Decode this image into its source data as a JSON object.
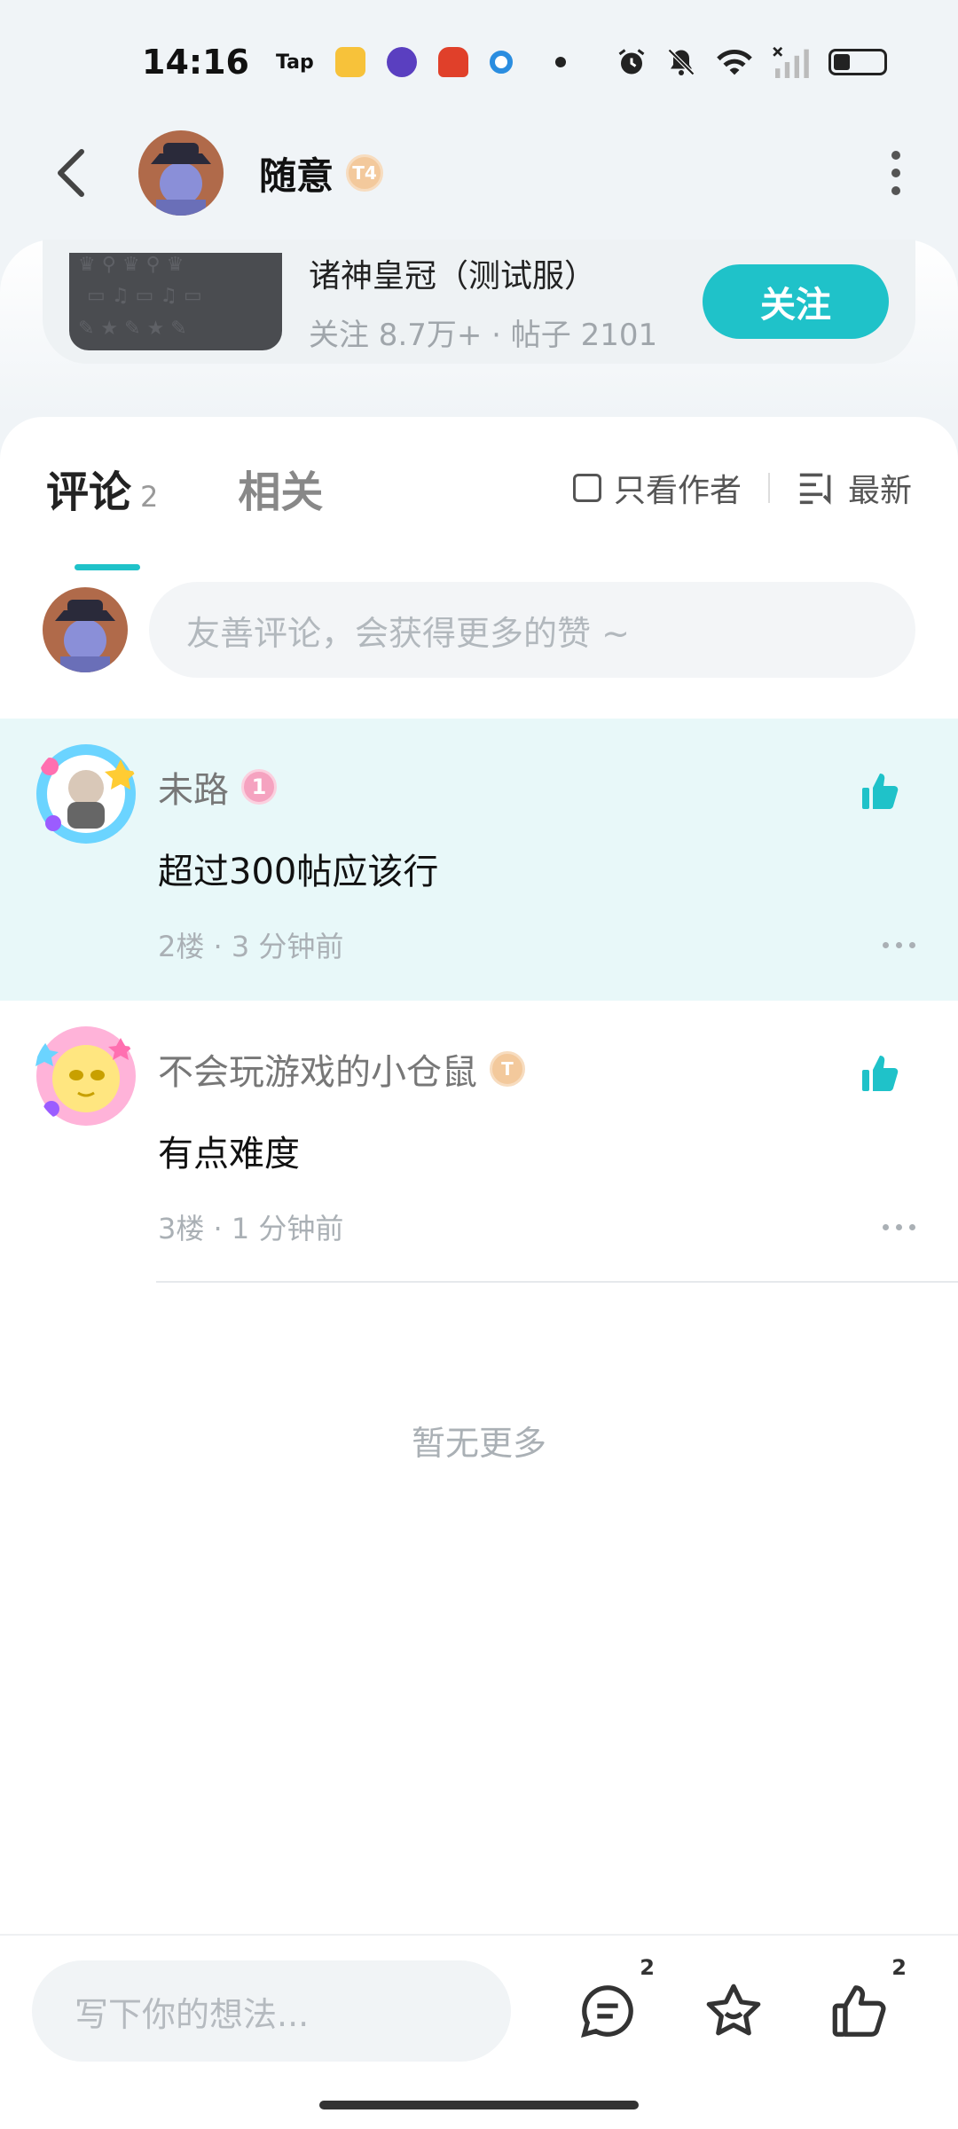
{
  "status_bar": {
    "time": "14:16",
    "apps": [
      "Tap",
      "book-app",
      "circle-app",
      "robot-app",
      "blue-dot-app"
    ]
  },
  "nav": {
    "title": "随意",
    "badge": "T4"
  },
  "game_card": {
    "name": "诸神皇冠（测试服）",
    "stats": "关注 8.7万+ · 帖子 2101",
    "follow_label": "关注"
  },
  "tabs": {
    "comments_label": "评论",
    "comments_count": "2",
    "related_label": "相关",
    "author_only_label": "只看作者",
    "sort_label": "最新"
  },
  "comment_input": {
    "placeholder": "友善评论，会获得更多的赞 ~"
  },
  "comments": [
    {
      "user": "未路",
      "badge_color": "#f5a3c0",
      "text": "超过300帖应该行",
      "meta": "2楼 · 3 分钟前"
    },
    {
      "user": "不会玩游戏的小仓鼠",
      "badge_color": "#f3c99c",
      "text": "有点难度",
      "meta": "3楼 · 1 分钟前"
    }
  ],
  "no_more": "暂无更多",
  "bottom_bar": {
    "placeholder": "写下你的想法...",
    "comment_count": "2",
    "like_count": "2"
  },
  "colors": {
    "accent": "#1fc2c9",
    "highlight_bg": "#e8f8f9"
  }
}
